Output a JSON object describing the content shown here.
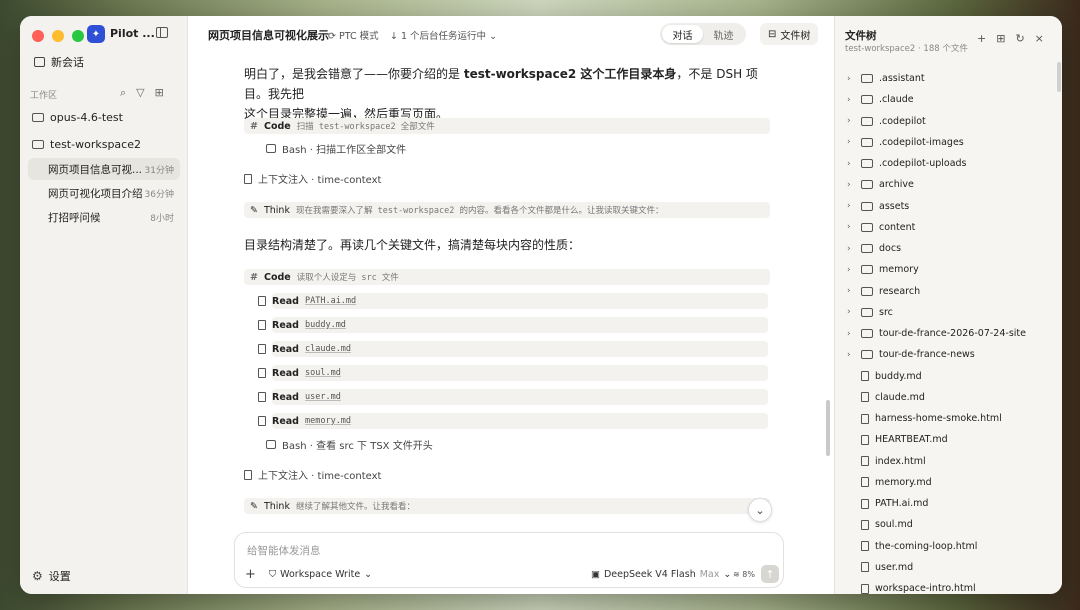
{
  "app": {
    "name": "Pilot ...",
    "logo_glyph": "✦"
  },
  "sidebar": {
    "new_chat": "新会话",
    "workspace_label": "工作区",
    "workspaces": [
      {
        "name": "opus-4.6-test"
      },
      {
        "name": "test-workspace2"
      }
    ],
    "conversations": [
      {
        "title": "网页项目信息可视...",
        "time": "31分钟",
        "active": true
      },
      {
        "title": "网页可视化项目介绍",
        "time": "36分钟",
        "active": false
      },
      {
        "title": "打招呼问候",
        "time": "8小时",
        "active": false
      }
    ],
    "settings": "设置"
  },
  "topbar": {
    "title": "网页项目信息可视化展示",
    "mode": "PTC 模式",
    "bg_tasks": "1 个后台任务运行中",
    "tabs": [
      {
        "label": "对话",
        "active": true
      },
      {
        "label": "轨迹",
        "active": false
      }
    ],
    "file_tree_btn": "文件树"
  },
  "conversation": {
    "msg1_a": "明白了，是我会错意了——你要介绍的是 ",
    "msg1_b": "test-workspace2 这个工作目录本身",
    "msg1_c": "，不是 DSH 项目。我先把",
    "msg1_d": "这个目录完整摸一遍，然后重写页面。",
    "code1_label": "Code",
    "code1_desc": "扫描 test-workspace2 全部文件",
    "bash1": "Bash · 扫描工作区全部文件",
    "ctx1": "上下文注入 · time-context",
    "think1_label": "Think",
    "think1_desc": "现在我需要深入了解 test-workspace2 的内容。看看各个文件都是什么。让我读取关键文件：",
    "msg2": "目录结构清楚了。再读几个关键文件，搞清楚每块内容的性质：",
    "code2_label": "Code",
    "code2_desc": "读取个人设定与 src 文件",
    "read_label": "Read",
    "reads": [
      "PATH.ai.md",
      "buddy.md",
      "claude.md",
      "soul.md",
      "user.md",
      "memory.md"
    ],
    "bash2": "Bash · 查看 src 下 TSX 文件开头",
    "ctx2": "上下文注入 · time-context",
    "think2_label": "Think",
    "think2_desc": "继续了解其他文件。让我看看："
  },
  "composer": {
    "placeholder": "给智能体发消息",
    "workspace_write": "Workspace Write",
    "model": "DeepSeek V4 Flash",
    "model_tier": "Max",
    "usage": "8%"
  },
  "file_tree": {
    "title": "文件树",
    "subtitle": "test-workspace2 · 188 个文件",
    "folders": [
      ".assistant",
      ".claude",
      ".codepilot",
      ".codepilot-images",
      ".codepilot-uploads",
      "archive",
      "assets",
      "content",
      "docs",
      "memory",
      "research",
      "src",
      "tour-de-france-2026-07-24-site",
      "tour-de-france-news"
    ],
    "files": [
      "buddy.md",
      "claude.md",
      "harness-home-smoke.html",
      "HEARTBEAT.md",
      "index.html",
      "memory.md",
      "PATH.ai.md",
      "soul.md",
      "the-coming-loop.html",
      "user.md",
      "workspace-intro.html"
    ]
  },
  "colors": {
    "accent": "#2e4fd6",
    "sidebar_bg": "#f3f2ef",
    "panel_bg": "#f6f5f2"
  }
}
